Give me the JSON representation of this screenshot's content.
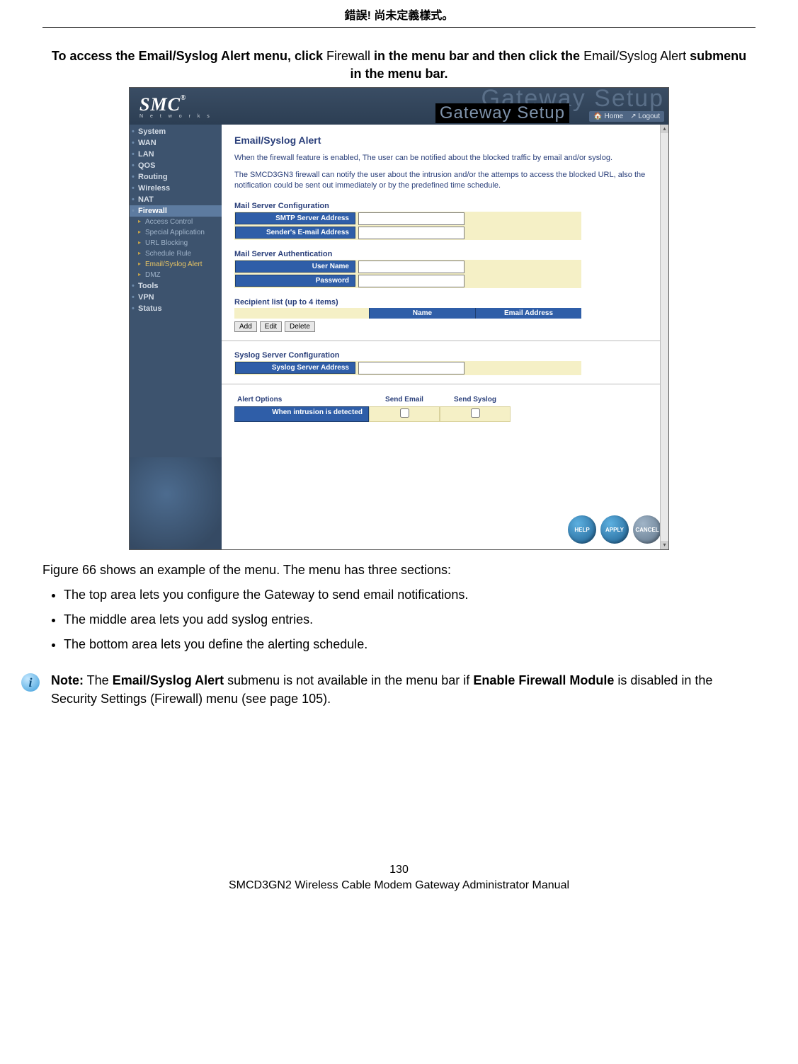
{
  "page_header": "錯誤! 尚未定義樣式。",
  "instruction": {
    "pre": "To access the Email/Syslog Alert menu, click ",
    "link1": "Firewall",
    "mid": " in the menu bar and then click the ",
    "link2": "Email/Syslog Alert",
    "post": " submenu in the menu bar."
  },
  "screenshot": {
    "logo_text": "SMC",
    "logo_reg": "®",
    "logo_sub": "N e t w o r k s",
    "ghost": "Gateway Setup",
    "ghost2": "Gateway Setup",
    "top_links": {
      "home": "Home",
      "logout": "Logout"
    },
    "nav": [
      "System",
      "WAN",
      "LAN",
      "QOS",
      "Routing",
      "Wireless",
      "NAT",
      "Firewall",
      "Tools",
      "VPN",
      "Status"
    ],
    "nav_active": "Firewall",
    "subnav": [
      "Access Control",
      "Special Application",
      "URL Blocking",
      "Schedule Rule",
      "Email/Syslog Alert",
      "DMZ"
    ],
    "subnav_current": "Email/Syslog Alert",
    "page_title": "Email/Syslog Alert",
    "intro1": "When the firewall feature is enabled, The user can be notified about the blocked traffic by email and/or syslog.",
    "intro2": "The SMCD3GN3 firewall can notify the user about the intrusion and/or the attemps to access the blocked URL, also the notification could be sent out immediately or by the predefined time schedule.",
    "sections": {
      "mail_cfg": "Mail Server Configuration",
      "smtp": "SMTP Server Address",
      "sender": "Sender's E-mail Address",
      "mail_auth": "Mail Server Authentication",
      "user": "User Name",
      "pass": "Password",
      "recip": "Recipient list (up to 4 items)",
      "th_name": "Name",
      "th_email": "Email Address",
      "syslog_cfg": "Syslog Server Configuration",
      "syslog_addr": "Syslog Server Address",
      "alert_opts": "Alert Options",
      "send_email": "Send Email",
      "send_syslog": "Send Syslog",
      "intrusion": "When intrusion is detected"
    },
    "buttons": {
      "add": "Add",
      "edit": "Edit",
      "delete": "Delete"
    },
    "round": {
      "help": "HELP",
      "apply": "APPLY",
      "cancel": "CANCEL"
    }
  },
  "figcaption": "Figure 66 shows an example of the menu. The menu has three sections:",
  "bullets": [
    "The top area lets you configure the Gateway to send email notifications.",
    "The middle area lets you add syslog entries.",
    "The bottom area lets you define the alerting schedule."
  ],
  "note": {
    "label": "Note:",
    "t1": " The ",
    "b1": "Email/Syslog Alert",
    "t2": " submenu is not available in the menu bar if ",
    "b2": "Enable Firewall Module",
    "t3": " is disabled in the Security Settings (Firewall) menu (see page 105)."
  },
  "footer": {
    "page_num": "130",
    "manual": "SMCD3GN2 Wireless Cable Modem Gateway Administrator Manual"
  }
}
